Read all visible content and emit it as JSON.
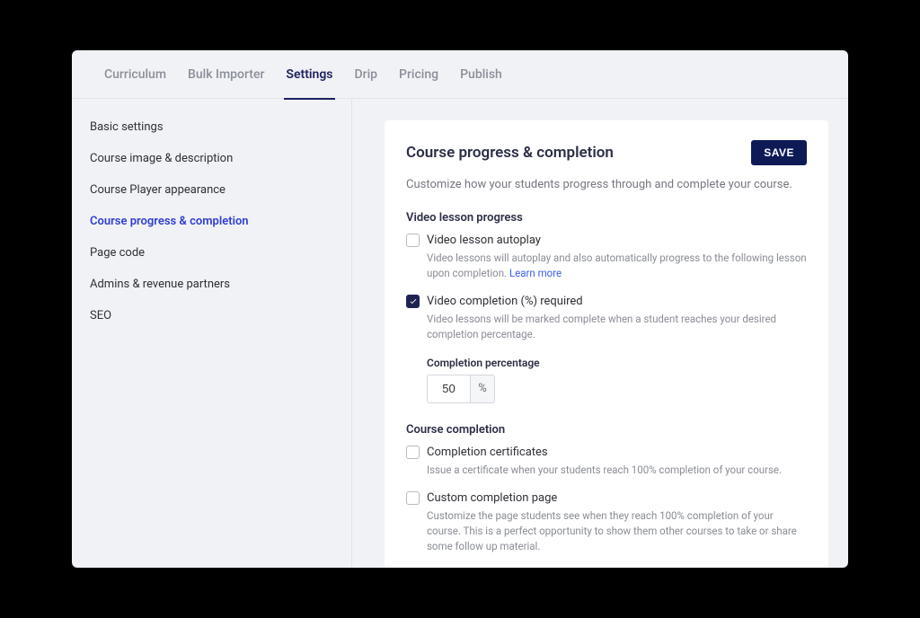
{
  "tabs": [
    {
      "label": "Curriculum"
    },
    {
      "label": "Bulk Importer"
    },
    {
      "label": "Settings"
    },
    {
      "label": "Drip"
    },
    {
      "label": "Pricing"
    },
    {
      "label": "Publish"
    }
  ],
  "active_tab_index": 2,
  "sidebar": [
    "Basic settings",
    "Course image & description",
    "Course Player appearance",
    "Course progress & completion",
    "Page code",
    "Admins & revenue partners",
    "SEO"
  ],
  "active_sidebar_index": 3,
  "card": {
    "title": "Course progress & completion",
    "save_label": "SAVE",
    "description": "Customize how your students progress through and complete your course.",
    "section_video": "Video lesson progress",
    "autoplay": {
      "label": "Video lesson autoplay",
      "help": "Video lessons will autoplay and also automatically progress to the following lesson upon completion. ",
      "learn_more": "Learn more",
      "checked": false
    },
    "required": {
      "label": "Video completion (%) required",
      "help": "Video lessons will be marked complete when a student reaches your desired completion percentage.",
      "checked": true,
      "percent_label": "Completion percentage",
      "percent_value": "50",
      "percent_suffix": "%"
    },
    "section_course": "Course completion",
    "certs": {
      "label": "Completion certificates",
      "help": "Issue a certificate when your students reach 100% completion of your course.",
      "checked": false
    },
    "custom_page": {
      "label": "Custom completion page",
      "help": "Customize the page students see when they reach 100% completion of your course. This is a perfect opportunity to show them other courses to take or share some follow up material.",
      "checked": false
    }
  }
}
